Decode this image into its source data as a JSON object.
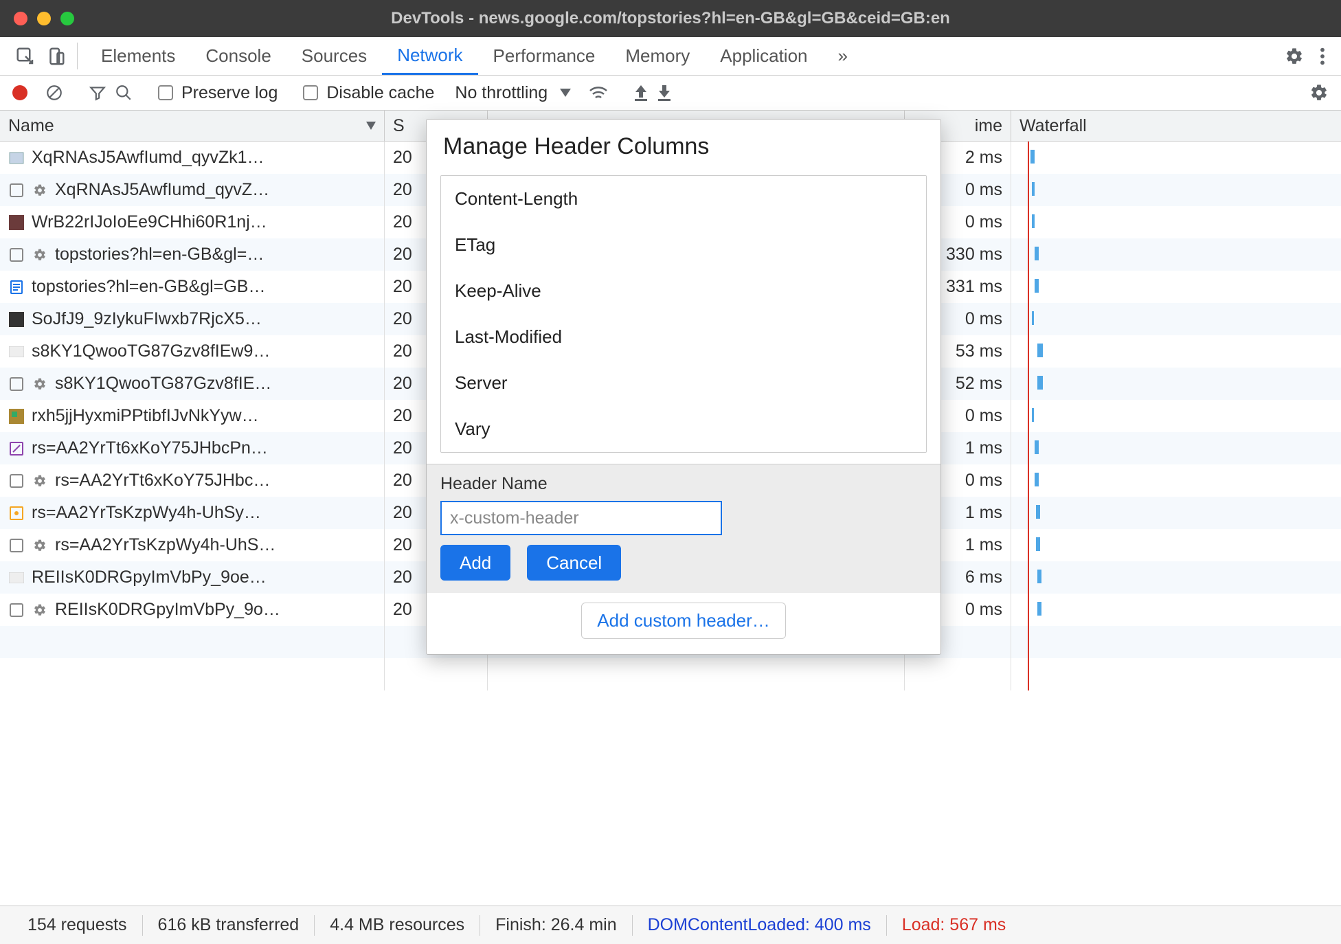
{
  "titlebar": {
    "title": "DevTools - news.google.com/topstories?hl=en-GB&gl=GB&ceid=GB:en"
  },
  "tabs": {
    "items": [
      "Elements",
      "Console",
      "Sources",
      "Network",
      "Performance",
      "Memory",
      "Application"
    ],
    "more": "»"
  },
  "toolbar": {
    "preserve_log": "Preserve log",
    "disable_cache": "Disable cache",
    "throttling": "No throttling"
  },
  "columns": {
    "name": "Name",
    "status": "S",
    "time": "ime",
    "waterfall": "Waterfall"
  },
  "rows": [
    {
      "icon": "img",
      "gear": false,
      "name": "XqRNAsJ5AwfIumd_qyvZk1…",
      "status": "20",
      "time": "2 ms",
      "wf": {
        "l": 28,
        "w": 6
      }
    },
    {
      "icon": "box",
      "gear": true,
      "name": "XqRNAsJ5AwfIumd_qyvZ…",
      "status": "20",
      "time": "0 ms",
      "wf": {
        "l": 30,
        "w": 4
      }
    },
    {
      "icon": "thumb",
      "gear": false,
      "name": "WrB22rIJoIoEe9CHhi60R1nj…",
      "status": "20",
      "time": "0 ms",
      "wf": {
        "l": 30,
        "w": 4
      }
    },
    {
      "icon": "box",
      "gear": true,
      "name": "topstories?hl=en-GB&gl=…",
      "status": "20",
      "time": "330 ms",
      "wf": {
        "l": 34,
        "w": 6
      }
    },
    {
      "icon": "doc",
      "gear": false,
      "name": "topstories?hl=en-GB&gl=GB…",
      "status": "20",
      "time": "331 ms",
      "wf": {
        "l": 34,
        "w": 6
      }
    },
    {
      "icon": "image",
      "gear": false,
      "name": "SoJfJ9_9zIykuFIwxb7RjcX5…",
      "status": "20",
      "time": "0 ms",
      "wf": {
        "l": 30,
        "w": 3
      }
    },
    {
      "icon": "blank",
      "gear": false,
      "name": "s8KY1QwooTG87Gzv8fIEw9…",
      "status": "20",
      "time": "53 ms",
      "wf": {
        "l": 38,
        "w": 8
      }
    },
    {
      "icon": "box",
      "gear": true,
      "name": "s8KY1QwooTG87Gzv8fIE…",
      "status": "20",
      "time": "52 ms",
      "wf": {
        "l": 38,
        "w": 8
      }
    },
    {
      "icon": "colorimg",
      "gear": false,
      "name": "rxh5jjHyxmiPPtibfIJvNkYyw…",
      "status": "20",
      "time": "0 ms",
      "wf": {
        "l": 30,
        "w": 3
      }
    },
    {
      "icon": "pencil",
      "gear": false,
      "name": "rs=AA2YrTt6xKoY75JHbcPn…",
      "status": "20",
      "time": "1 ms",
      "wf": {
        "l": 34,
        "w": 6
      }
    },
    {
      "icon": "box",
      "gear": true,
      "name": "rs=AA2YrTt6xKoY75JHbc…",
      "status": "20",
      "time": "0 ms",
      "wf": {
        "l": 34,
        "w": 6
      }
    },
    {
      "icon": "script",
      "gear": false,
      "name": "rs=AA2YrTsKzpWy4h-UhSy…",
      "status": "20",
      "time": "1 ms",
      "wf": {
        "l": 36,
        "w": 6
      }
    },
    {
      "icon": "box",
      "gear": true,
      "name": "rs=AA2YrTsKzpWy4h-UhS…",
      "status": "20",
      "time": "1 ms",
      "wf": {
        "l": 36,
        "w": 6
      }
    },
    {
      "icon": "blank",
      "gear": false,
      "name": "REIIsK0DRGpyImVbPy_9oe…",
      "status": "20",
      "time": "6 ms",
      "wf": {
        "l": 38,
        "w": 6
      }
    },
    {
      "icon": "box",
      "gear": true,
      "name": "REIIsK0DRGpyImVbPy_9o…",
      "status": "20",
      "time": "0 ms",
      "wf": {
        "l": 38,
        "w": 6
      }
    }
  ],
  "status": {
    "requests": "154 requests",
    "transferred": "616 kB transferred",
    "resources": "4.4 MB resources",
    "finish": "Finish: 26.4 min",
    "dcl": "DOMContentLoaded: 400 ms",
    "load": "Load: 567 ms"
  },
  "modal": {
    "title": "Manage Header Columns",
    "items": [
      "Content-Length",
      "ETag",
      "Keep-Alive",
      "Last-Modified",
      "Server",
      "Vary"
    ],
    "field_label": "Header Name",
    "placeholder": "x-custom-header",
    "add": "Add",
    "cancel": "Cancel",
    "add_custom": "Add custom header…"
  }
}
